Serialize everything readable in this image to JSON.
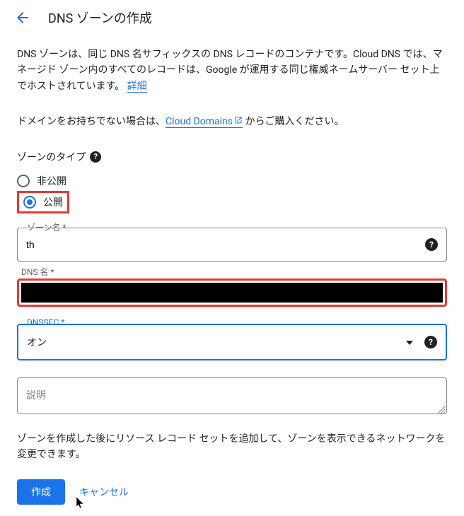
{
  "header": {
    "title": "DNS ゾーンの作成"
  },
  "description": {
    "text": "DNS ゾーンは、同じ DNS 名サフィックスの DNS レコードのコンテナです。Cloud DNS では、マネージド ゾーン内のすべてのレコードは、Google が運用する同じ権威ネームサーバー セット上でホストされています。",
    "details_link": "詳細"
  },
  "domain": {
    "prefix": "ドメインをお持ちでない場合は、",
    "link": "Cloud Domains",
    "suffix": " からご購入ください。"
  },
  "zone_type": {
    "label": "ゾーンのタイプ",
    "options": {
      "private": "非公開",
      "public": "公開"
    },
    "selected": "public"
  },
  "fields": {
    "zone_name": {
      "label": "ゾーン名 *",
      "value": "th"
    },
    "dns_name": {
      "label": "DNS 名 *",
      "value": ""
    },
    "dnssec": {
      "label": "DNSSEC *",
      "value": "オン"
    },
    "description": {
      "placeholder": "説明"
    }
  },
  "bottom_text": "ゾーンを作成した後にリソース レコード セットを追加して、ゾーンを表示できるネットワークを変更できます。",
  "buttons": {
    "create": "作成",
    "cancel": "キャンセル"
  }
}
